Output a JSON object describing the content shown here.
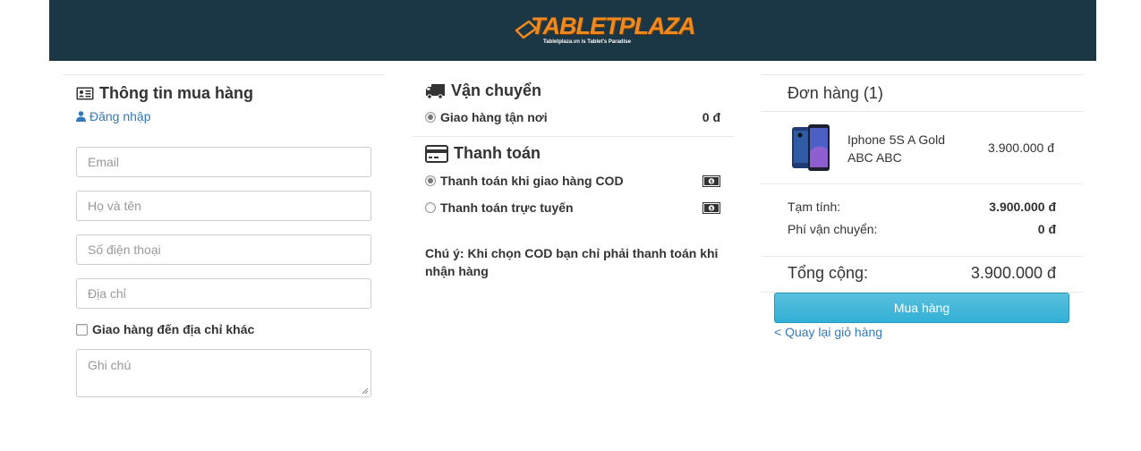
{
  "header": {
    "logo_text": "TABLETPLAZA",
    "logo_tagline": "Tabletplaza.vn is Tablet's Paradise",
    "bg_color": "#1b3645",
    "logo_color": "#ef8a20"
  },
  "customer": {
    "title": "Thông tin mua hàng",
    "title_icon": "id-card-icon",
    "login_label": "Đăng nhập",
    "email_placeholder": "Email",
    "name_placeholder": "Họ và tên",
    "phone_placeholder": "Số điện thoại",
    "address_placeholder": "Địa chỉ",
    "other_address_label": "Giao hàng đến địa chỉ khác",
    "other_address_checked": false,
    "note_placeholder": "Ghi chú"
  },
  "shipping": {
    "title": "Vận chuyển",
    "title_icon": "truck-icon",
    "option_label": "Giao hàng tận nơi",
    "option_price": "0 đ",
    "option_selected": true
  },
  "payment": {
    "title": "Thanh toán",
    "title_icon": "credit-card-icon",
    "options": [
      {
        "label": "Thanh toán khi giao hàng COD",
        "icon": "cash-icon",
        "selected": true
      },
      {
        "label": "Thanh toán trực tuyến",
        "icon": "cash-icon",
        "selected": false
      }
    ],
    "note": "Chú ý: Khi chọn COD bạn chỉ phải thanh toán khi nhận hàng"
  },
  "order": {
    "title": "Đơn hàng (1)",
    "item": {
      "name": "Iphone 5S A Gold ABC ABC",
      "price": "3.900.000 đ",
      "image_icon": "phone-image"
    },
    "subtotal_label": "Tạm tính:",
    "subtotal_value": "3.900.000 đ",
    "shipping_label": "Phí vận chuyển:",
    "shipping_value": "0 đ",
    "total_label": "Tổng cộng:",
    "total_value": "3.900.000 đ",
    "buy_label": "Mua hàng",
    "back_label": "< Quay lại giỏ hàng",
    "accent": "#5bc0de",
    "link_color": "#337ab7"
  }
}
